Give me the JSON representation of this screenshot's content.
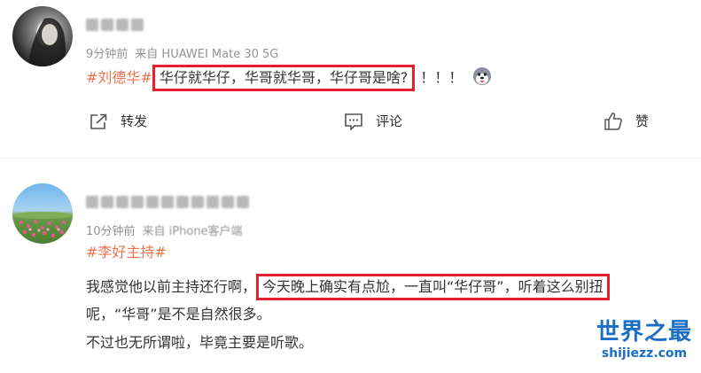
{
  "comments": [
    {
      "time": "9分钟前",
      "source": "来自 HUAWEI Mate 30 5G",
      "hashtag": "#刘德华#",
      "highlighted_text": "华仔就华仔，华哥就华哥，华仔哥是啥?",
      "trailing_text": "！！！",
      "emoji_icon": "husky-emoji-icon",
      "actions": {
        "repost": "转发",
        "comment": "评论",
        "like": "赞"
      }
    },
    {
      "time": "10分钟前",
      "source": "来自 iPhone客户端",
      "hashtag": "#李好主持#",
      "line1_before": "我感觉他以前主持还行啊，",
      "line1_highlight": "今天晚上确实有点尬，一直叫“华仔哥”，听着这么别扭",
      "line2": "呢，“华哥”是不是自然很多。",
      "line3": "不过也无所谓啦，毕竟主要是听歌。"
    }
  ],
  "watermark": {
    "title": "世界之最",
    "url": "shijiezz.com"
  },
  "colors": {
    "hashtag": "#eb7350",
    "highlight_border": "#e8202c",
    "meta": "#939393",
    "watermark": "#1a6fc4"
  }
}
